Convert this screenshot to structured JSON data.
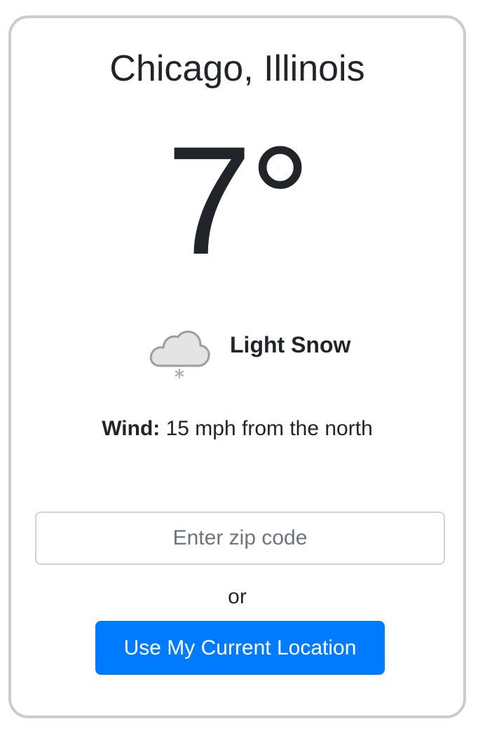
{
  "weather": {
    "location": "Chicago, Illinois",
    "temperature": "7°",
    "condition_icon": "light-snow-cloud-icon",
    "condition": "Light Snow",
    "wind_label": "Wind:",
    "wind_value": " 15 mph from the north"
  },
  "search": {
    "placeholder": "Enter zip code",
    "value": "",
    "or_text": "or",
    "location_button_label": "Use My Current Location"
  },
  "colors": {
    "button_bg": "#007bff",
    "card_border": "#cccccc",
    "text": "#212529"
  }
}
